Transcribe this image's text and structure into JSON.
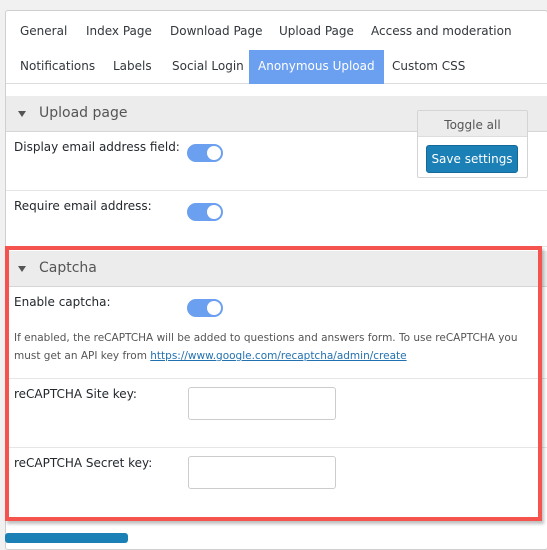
{
  "tabs": [
    {
      "label": "General",
      "active": false
    },
    {
      "label": "Index Page",
      "active": false
    },
    {
      "label": "Download Page",
      "active": false
    },
    {
      "label": "Upload Page",
      "active": false
    },
    {
      "label": "Access and moderation",
      "active": false
    },
    {
      "label": "Notifications",
      "active": false
    },
    {
      "label": "Labels",
      "active": false
    },
    {
      "label": "Social Login",
      "active": false
    },
    {
      "label": "Anonymous Upload",
      "active": true
    },
    {
      "label": "Custom CSS",
      "active": false
    }
  ],
  "upload_section": {
    "title": "Upload page",
    "rows": [
      {
        "label": "Display email address field:",
        "enabled": true
      },
      {
        "label": "Require email address:",
        "enabled": true
      }
    ]
  },
  "floating_actions": {
    "toggle_all": "Toggle all",
    "save": "Save settings"
  },
  "captcha_section": {
    "title": "Captcha",
    "enable_label": "Enable captcha:",
    "enable_value": true,
    "help_text": "If enabled, the reCAPTCHA will be added to questions and answers form. To use reCAPTCHA you must get an API key from ",
    "help_link": "https://www.google.com/recaptcha/admin/create",
    "site_key_label": "reCAPTCHA Site key:",
    "site_key_value": "",
    "secret_key_label": "reCAPTCHA Secret key:",
    "secret_key_value": ""
  },
  "colors": {
    "accent": "#6b9ff0",
    "button": "#1a80b6",
    "highlight": "#f4544d"
  }
}
